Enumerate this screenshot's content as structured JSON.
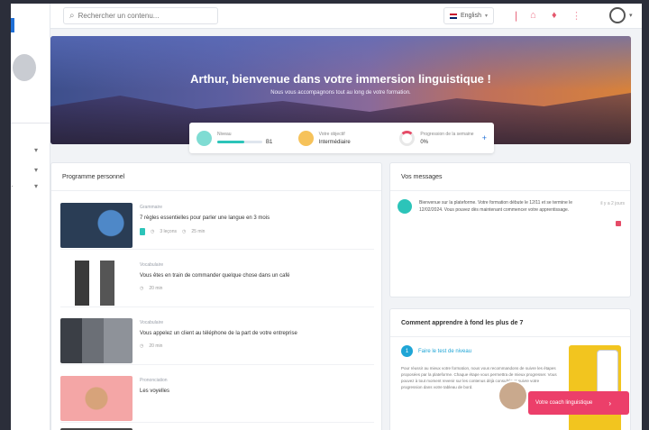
{
  "topbar": {
    "search_placeholder": "Rechercher un contenu...",
    "language": "English"
  },
  "hero": {
    "title": "Arthur, bienvenue dans votre immersion linguistique !",
    "subtitle": "Nous vous accompagnons tout au long de votre formation."
  },
  "stats": [
    {
      "label": "Niveau",
      "value": "B1"
    },
    {
      "label": "Votre objectif",
      "value": "Intermédiaire"
    },
    {
      "label": "Progression de la semaine",
      "value": "0%"
    }
  ],
  "programme": {
    "title": "Programme personnel",
    "items": [
      {
        "category": "Grammaire",
        "title": "7 règles essentielles pour parler une langue en 3 mois",
        "meta1": "3 leçons",
        "meta2": "25 min"
      },
      {
        "category": "Vocabulaire",
        "title": "Vous êtes en train de commander quelque chose dans un café",
        "meta1": "20 min",
        "meta2": ""
      },
      {
        "category": "Vocabulaire",
        "title": "Vous appelez un client au téléphone de la part de votre entreprise",
        "meta1": "20 min",
        "meta2": ""
      },
      {
        "category": "Prononciation",
        "title": "Les voyelles",
        "meta1": "",
        "meta2": ""
      }
    ]
  },
  "messages": {
    "title": "Vos messages",
    "items": [
      {
        "text": "Bienvenue sur la plateforme. Votre formation débute le 12/11 et se termine le 12/02/2024. Vous pouvez dès maintenant commencer votre apprentissage.",
        "date": "il y a 2 jours"
      }
    ]
  },
  "tips": {
    "title": "Comment apprendre à fond les plus de 7",
    "step_number": "1",
    "step_link": "Faire le test de niveau",
    "body": "Pour réussir au mieux votre formation, nous vous recommandons de suivre les étapes proposées par la plateforme. Chaque étape vous permettra de mieux progresser. Vous pouvez à tout moment revenir sur les contenus déjà consultés et suivre votre progression dans votre tableau de bord."
  },
  "cta": {
    "label": "Votre coach linguistique"
  },
  "colors": {
    "accent": "#2cc4b9",
    "cta": "#ec3f6a",
    "link": "#1fa5d6"
  }
}
